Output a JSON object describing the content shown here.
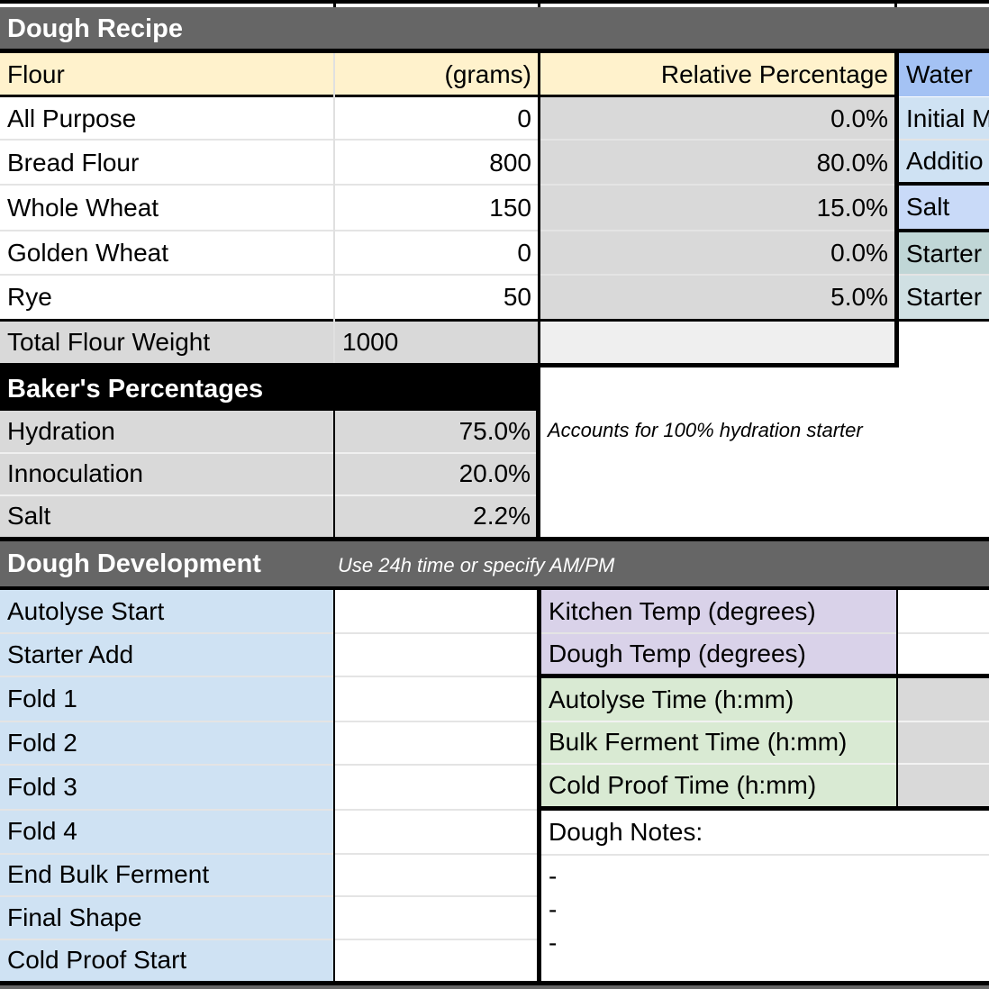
{
  "colors": {
    "section_header": "#666666",
    "bakers_header": "#000000",
    "flour_header": "#fff2cc",
    "gray_cell": "#d9d9d9",
    "light_gray": "#efefef",
    "blue_light": "#cfe2f3",
    "blue_header": "#a4c2f4",
    "blue_salt": "#c9daf8",
    "starter_teal": "#c0d6d6",
    "purple_light": "#d9d2e9",
    "green_light": "#d9ead3"
  },
  "dough_recipe": {
    "title": "Dough Recipe",
    "headers": {
      "flour": "Flour",
      "grams": "(grams)",
      "relative": "Relative Percentage"
    },
    "rows": [
      {
        "name": "All Purpose",
        "grams": "0",
        "pct": "0.0%"
      },
      {
        "name": "Bread Flour",
        "grams": "800",
        "pct": "80.0%"
      },
      {
        "name": "Whole Wheat",
        "grams": "150",
        "pct": "15.0%"
      },
      {
        "name": "Golden Wheat",
        "grams": "0",
        "pct": "0.0%"
      },
      {
        "name": "Rye",
        "grams": "50",
        "pct": "5.0%"
      }
    ],
    "total_label": "Total Flour Weight",
    "total_value": "1000"
  },
  "right_panel": {
    "water": "Water",
    "initial": "Initial M",
    "additional": "Additio",
    "salt": "Salt",
    "starter1": "Starter",
    "starter2": "Starter"
  },
  "bakers": {
    "title": "Baker's Percentages",
    "note": "Accounts for 100% hydration starter",
    "rows": [
      {
        "label": "Hydration",
        "value": "75.0%"
      },
      {
        "label": "Innoculation",
        "value": "20.0%"
      },
      {
        "label": "Salt",
        "value": "2.2%"
      }
    ]
  },
  "development": {
    "title": "Dough Development",
    "note": "Use 24h time or specify AM/PM",
    "steps": [
      "Autolyse Start",
      "Starter Add",
      "Fold 1",
      "Fold 2",
      "Fold 3",
      "Fold 4",
      "End Bulk Ferment",
      "Final Shape",
      "Cold Proof Start"
    ],
    "temps": [
      "Kitchen Temp (degrees)",
      "Dough Temp (degrees)"
    ],
    "times": [
      "Autolyse Time (h:mm)",
      "Bulk Ferment Time (h:mm)",
      "Cold Proof Time (h:mm)"
    ],
    "notes_label": "Dough Notes:",
    "note_lines": [
      "-",
      "-",
      "-"
    ]
  }
}
